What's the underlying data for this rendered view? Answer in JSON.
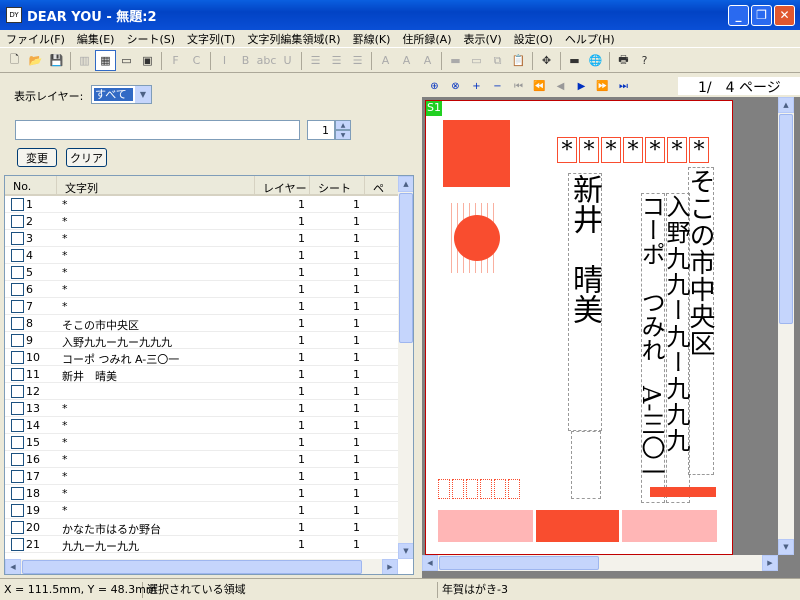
{
  "window": {
    "title": "DEAR YOU - 無題:2",
    "icon_text": "DY"
  },
  "menu": [
    "ファイル(F)",
    "編集(E)",
    "シート(S)",
    "文字列(T)",
    "文字列編集領域(R)",
    "罫線(K)",
    "住所録(A)",
    "表示(V)",
    "設定(O)",
    "ヘルプ(H)"
  ],
  "toolbar": [
    {
      "icon": "new-file-icon",
      "glyph": "🗋",
      "state": "on"
    },
    {
      "icon": "open-folder-icon",
      "glyph": "📂",
      "state": "on"
    },
    {
      "icon": "save-icon",
      "glyph": "💾",
      "state": "on"
    },
    {
      "icon": "chart-icon",
      "glyph": "▥",
      "state": "dis"
    },
    {
      "icon": "table-view-icon",
      "glyph": "▦",
      "state": "act"
    },
    {
      "icon": "window-icon",
      "glyph": "▭",
      "state": "on"
    },
    {
      "icon": "screen-icon",
      "glyph": "▣",
      "state": "on"
    },
    {
      "icon": "font-icon",
      "glyph": "F",
      "state": "dis"
    },
    {
      "icon": "color-icon",
      "glyph": "C",
      "state": "dis"
    },
    {
      "icon": "italic-icon",
      "glyph": "I",
      "state": "dis"
    },
    {
      "icon": "bold-icon",
      "glyph": "B",
      "state": "dis"
    },
    {
      "icon": "strikethrough-icon",
      "glyph": "abc",
      "state": "dis"
    },
    {
      "icon": "underline-icon",
      "glyph": "U",
      "state": "dis"
    },
    {
      "icon": "align-left-icon",
      "glyph": "☰",
      "state": "dis"
    },
    {
      "icon": "align-center-icon",
      "glyph": "☰",
      "state": "dis"
    },
    {
      "icon": "align-right-icon",
      "glyph": "☰",
      "state": "dis"
    },
    {
      "icon": "text-fit-icon",
      "glyph": "A",
      "state": "dis"
    },
    {
      "icon": "text-spacing-icon",
      "glyph": "A",
      "state": "dis"
    },
    {
      "icon": "text-fill-icon",
      "glyph": "A",
      "state": "dis"
    },
    {
      "icon": "frame-icon",
      "glyph": "▬",
      "state": "dis"
    },
    {
      "icon": "frame2-icon",
      "glyph": "▭",
      "state": "dis"
    },
    {
      "icon": "copy-icon",
      "glyph": "⧉",
      "state": "dis"
    },
    {
      "icon": "paste-icon",
      "glyph": "📋",
      "state": "dis"
    },
    {
      "icon": "move-icon",
      "glyph": "✥",
      "state": "on"
    },
    {
      "icon": "line-icon",
      "glyph": "▬",
      "state": "on"
    },
    {
      "icon": "globe-icon",
      "glyph": "🌐",
      "state": "on"
    },
    {
      "icon": "printer-icon",
      "glyph": "🖶",
      "state": "on"
    },
    {
      "icon": "help-icon",
      "glyph": "?",
      "state": "on"
    }
  ],
  "left": {
    "layer_label": "表示レイヤー:",
    "layer_value": "すべて",
    "text_input_value": "",
    "num_value": "1",
    "change_label": "変更",
    "clear_label": "クリア",
    "columns": [
      "No.",
      "文字列",
      "レイヤー",
      "シート",
      "ペ"
    ],
    "rows": [
      {
        "no": "1",
        "text": "*",
        "layer": "1",
        "sheet": "1"
      },
      {
        "no": "2",
        "text": "*",
        "layer": "1",
        "sheet": "1"
      },
      {
        "no": "3",
        "text": "*",
        "layer": "1",
        "sheet": "1"
      },
      {
        "no": "4",
        "text": "*",
        "layer": "1",
        "sheet": "1"
      },
      {
        "no": "5",
        "text": "*",
        "layer": "1",
        "sheet": "1"
      },
      {
        "no": "6",
        "text": "*",
        "layer": "1",
        "sheet": "1"
      },
      {
        "no": "7",
        "text": "*",
        "layer": "1",
        "sheet": "1"
      },
      {
        "no": "8",
        "text": "そこの市中央区",
        "layer": "1",
        "sheet": "1"
      },
      {
        "no": "9",
        "text": "入野九九ー九ー九九九",
        "layer": "1",
        "sheet": "1"
      },
      {
        "no": "10",
        "text": "コーポ つみれ A-三〇一",
        "layer": "1",
        "sheet": "1"
      },
      {
        "no": "11",
        "text": "新井　晴美",
        "layer": "1",
        "sheet": "1"
      },
      {
        "no": "12",
        "text": "",
        "layer": "1",
        "sheet": "1"
      },
      {
        "no": "13",
        "text": "*",
        "layer": "1",
        "sheet": "1"
      },
      {
        "no": "14",
        "text": "*",
        "layer": "1",
        "sheet": "1"
      },
      {
        "no": "15",
        "text": "*",
        "layer": "1",
        "sheet": "1"
      },
      {
        "no": "16",
        "text": "*",
        "layer": "1",
        "sheet": "1"
      },
      {
        "no": "17",
        "text": "*",
        "layer": "1",
        "sheet": "1"
      },
      {
        "no": "18",
        "text": "*",
        "layer": "1",
        "sheet": "1"
      },
      {
        "no": "19",
        "text": "*",
        "layer": "1",
        "sheet": "1"
      },
      {
        "no": "20",
        "text": "かなた市はるか野台",
        "layer": "1",
        "sheet": "1"
      },
      {
        "no": "21",
        "text": "九九ー九ー九九",
        "layer": "1",
        "sheet": "1"
      }
    ]
  },
  "right": {
    "page_indicator": "1/　4 ページ",
    "sheet_tag": "S1",
    "zip_chars": [
      "*",
      "*",
      "*",
      "*",
      "*",
      "*",
      "*"
    ],
    "address1": "そこの市中央区",
    "address2": "入野九九ー九ー九九九",
    "address3": "コーポ　つみれ　A-三〇一",
    "name": "新井　晴美"
  },
  "status": {
    "coords": "X = 111.5mm, Y = 48.3mm",
    "selection": "選択されている領域",
    "card_type": "年賀はがき-3"
  }
}
